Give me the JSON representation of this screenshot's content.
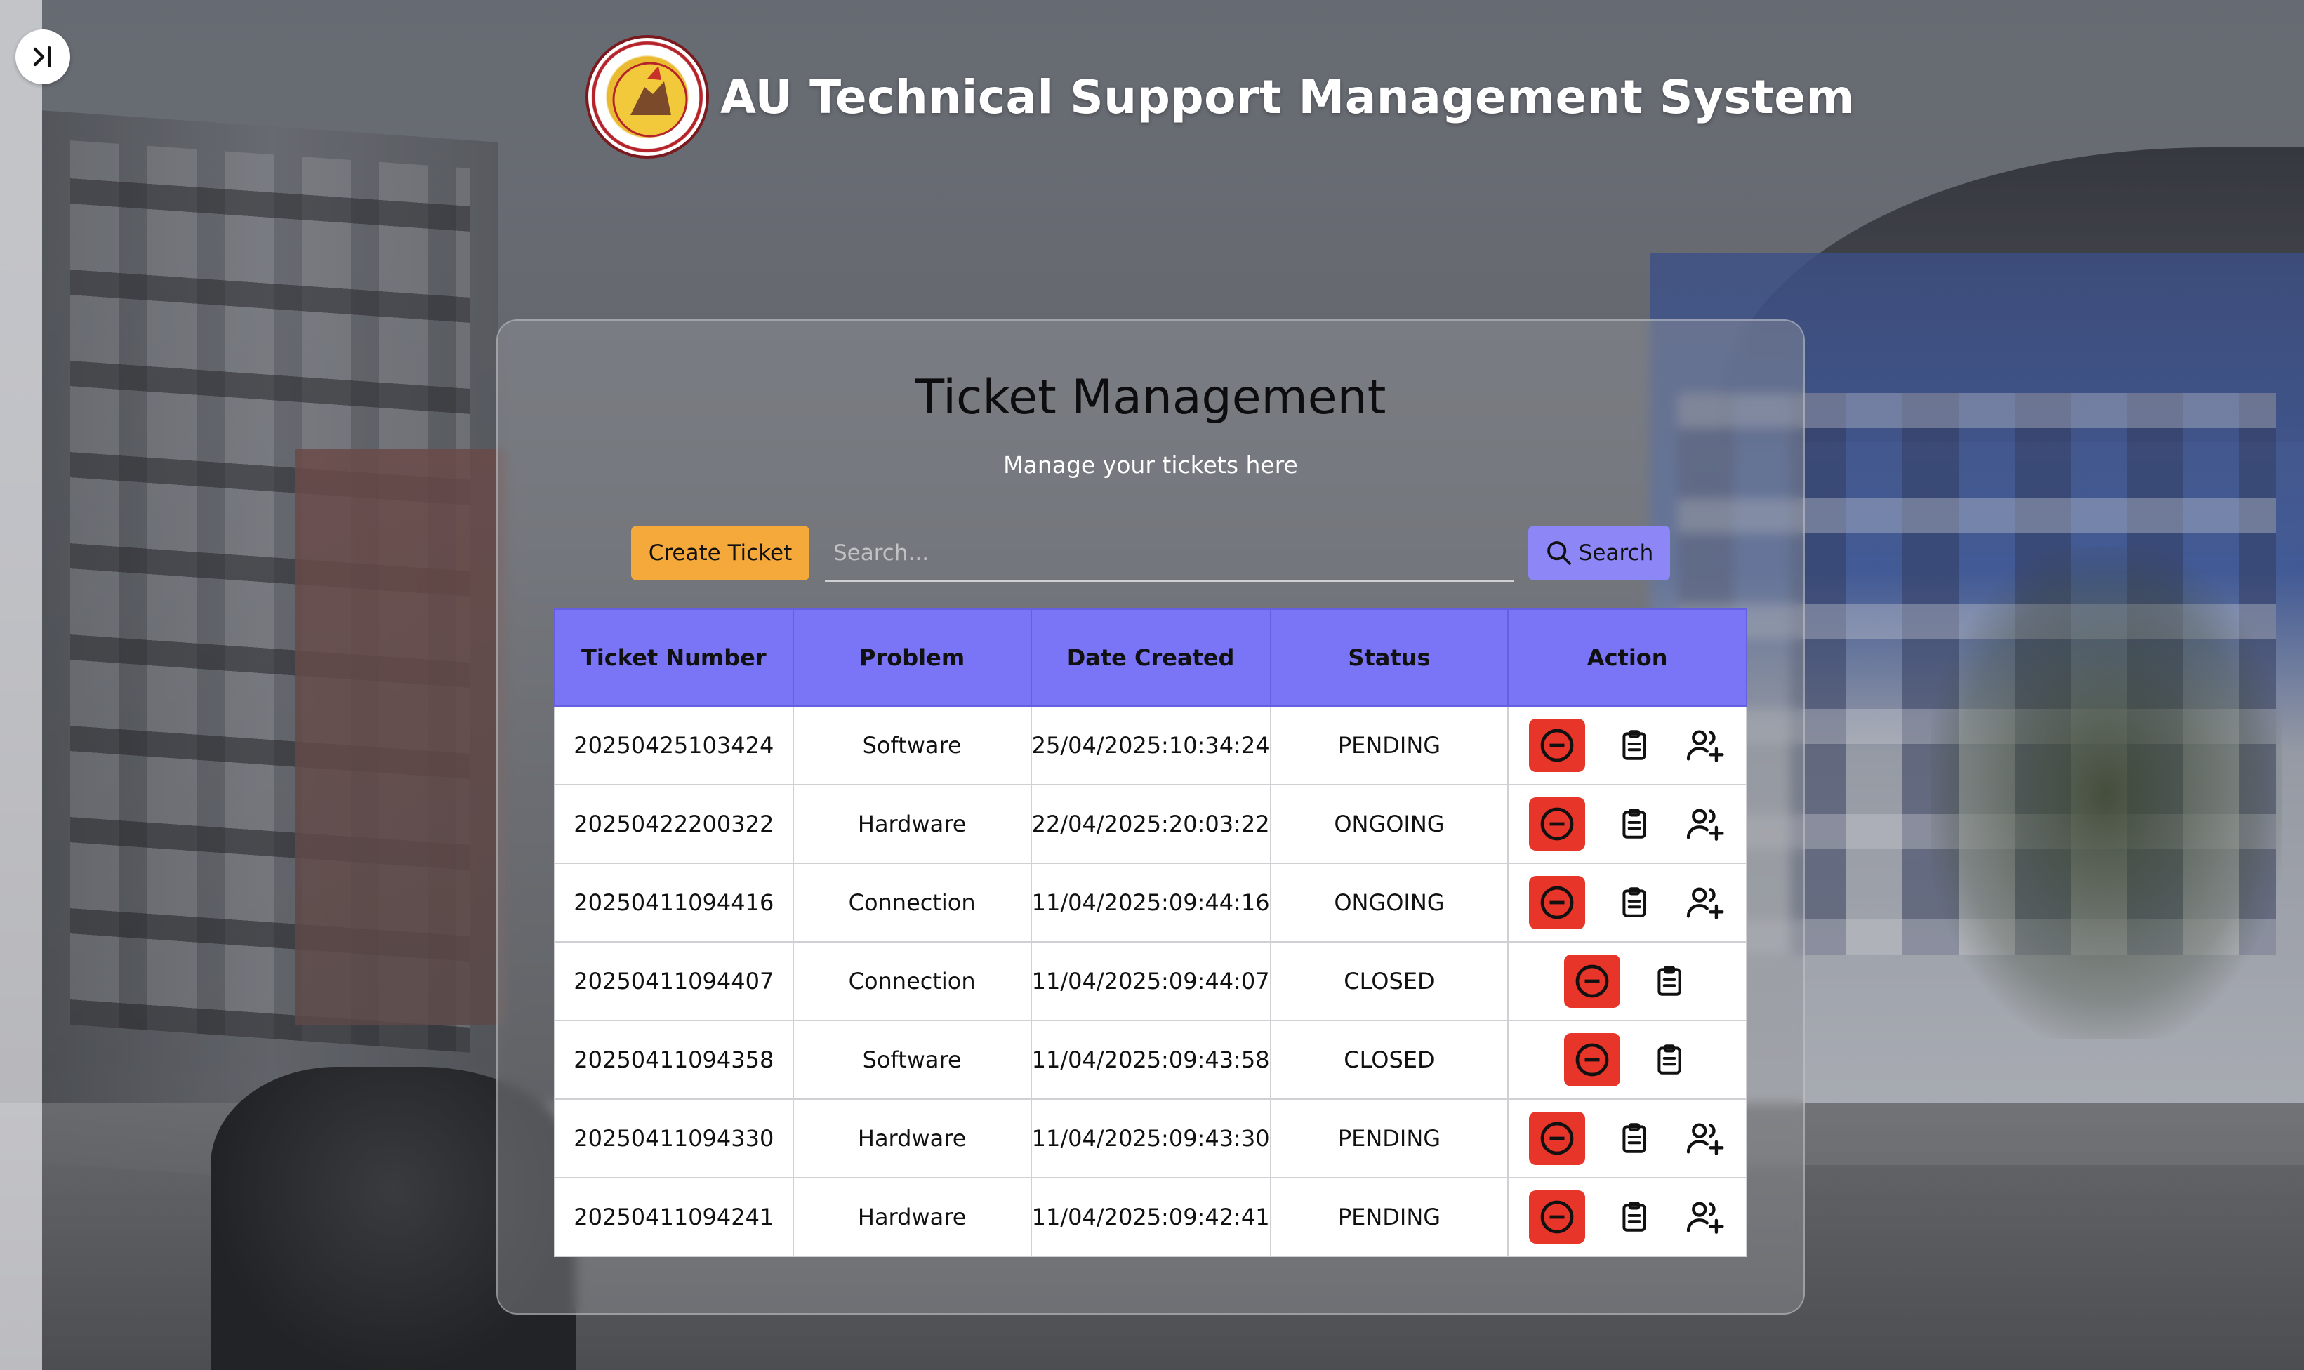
{
  "header": {
    "title": "AU Technical Support Management System",
    "logo_icon": "university-seal-logo"
  },
  "sidebar_toggle": {
    "icon": "sidebar-expand-icon"
  },
  "card": {
    "title": "Ticket Management",
    "subtitle": "Manage your tickets here"
  },
  "toolbar": {
    "create_label": "Create Ticket",
    "search_placeholder": "Search...",
    "search_label": "Search"
  },
  "table": {
    "columns": [
      "Ticket Number",
      "Problem",
      "Date Created",
      "Status",
      "Action"
    ],
    "rows": [
      {
        "number": "20250425103424",
        "problem": "Software",
        "date": "25/04/2025:10:34:24",
        "status": "PENDING",
        "actions": [
          "delete",
          "details",
          "assign"
        ]
      },
      {
        "number": "20250422200322",
        "problem": "Hardware",
        "date": "22/04/2025:20:03:22",
        "status": "ONGOING",
        "actions": [
          "delete",
          "details",
          "assign"
        ]
      },
      {
        "number": "20250411094416",
        "problem": "Connection",
        "date": "11/04/2025:09:44:16",
        "status": "ONGOING",
        "actions": [
          "delete",
          "details",
          "assign"
        ]
      },
      {
        "number": "20250411094407",
        "problem": "Connection",
        "date": "11/04/2025:09:44:07",
        "status": "CLOSED",
        "actions": [
          "delete",
          "details"
        ]
      },
      {
        "number": "20250411094358",
        "problem": "Software",
        "date": "11/04/2025:09:43:58",
        "status": "CLOSED",
        "actions": [
          "delete",
          "details"
        ]
      },
      {
        "number": "20250411094330",
        "problem": "Hardware",
        "date": "11/04/2025:09:43:30",
        "status": "PENDING",
        "actions": [
          "delete",
          "details",
          "assign"
        ]
      },
      {
        "number": "20250411094241",
        "problem": "Hardware",
        "date": "11/04/2025:09:42:41",
        "status": "PENDING",
        "actions": [
          "delete",
          "details",
          "assign"
        ]
      }
    ]
  },
  "colors": {
    "accent": "#7a75f6",
    "create_button": "#f6a93b",
    "search_button": "#8c86f7",
    "delete_button": "#e8352a"
  }
}
